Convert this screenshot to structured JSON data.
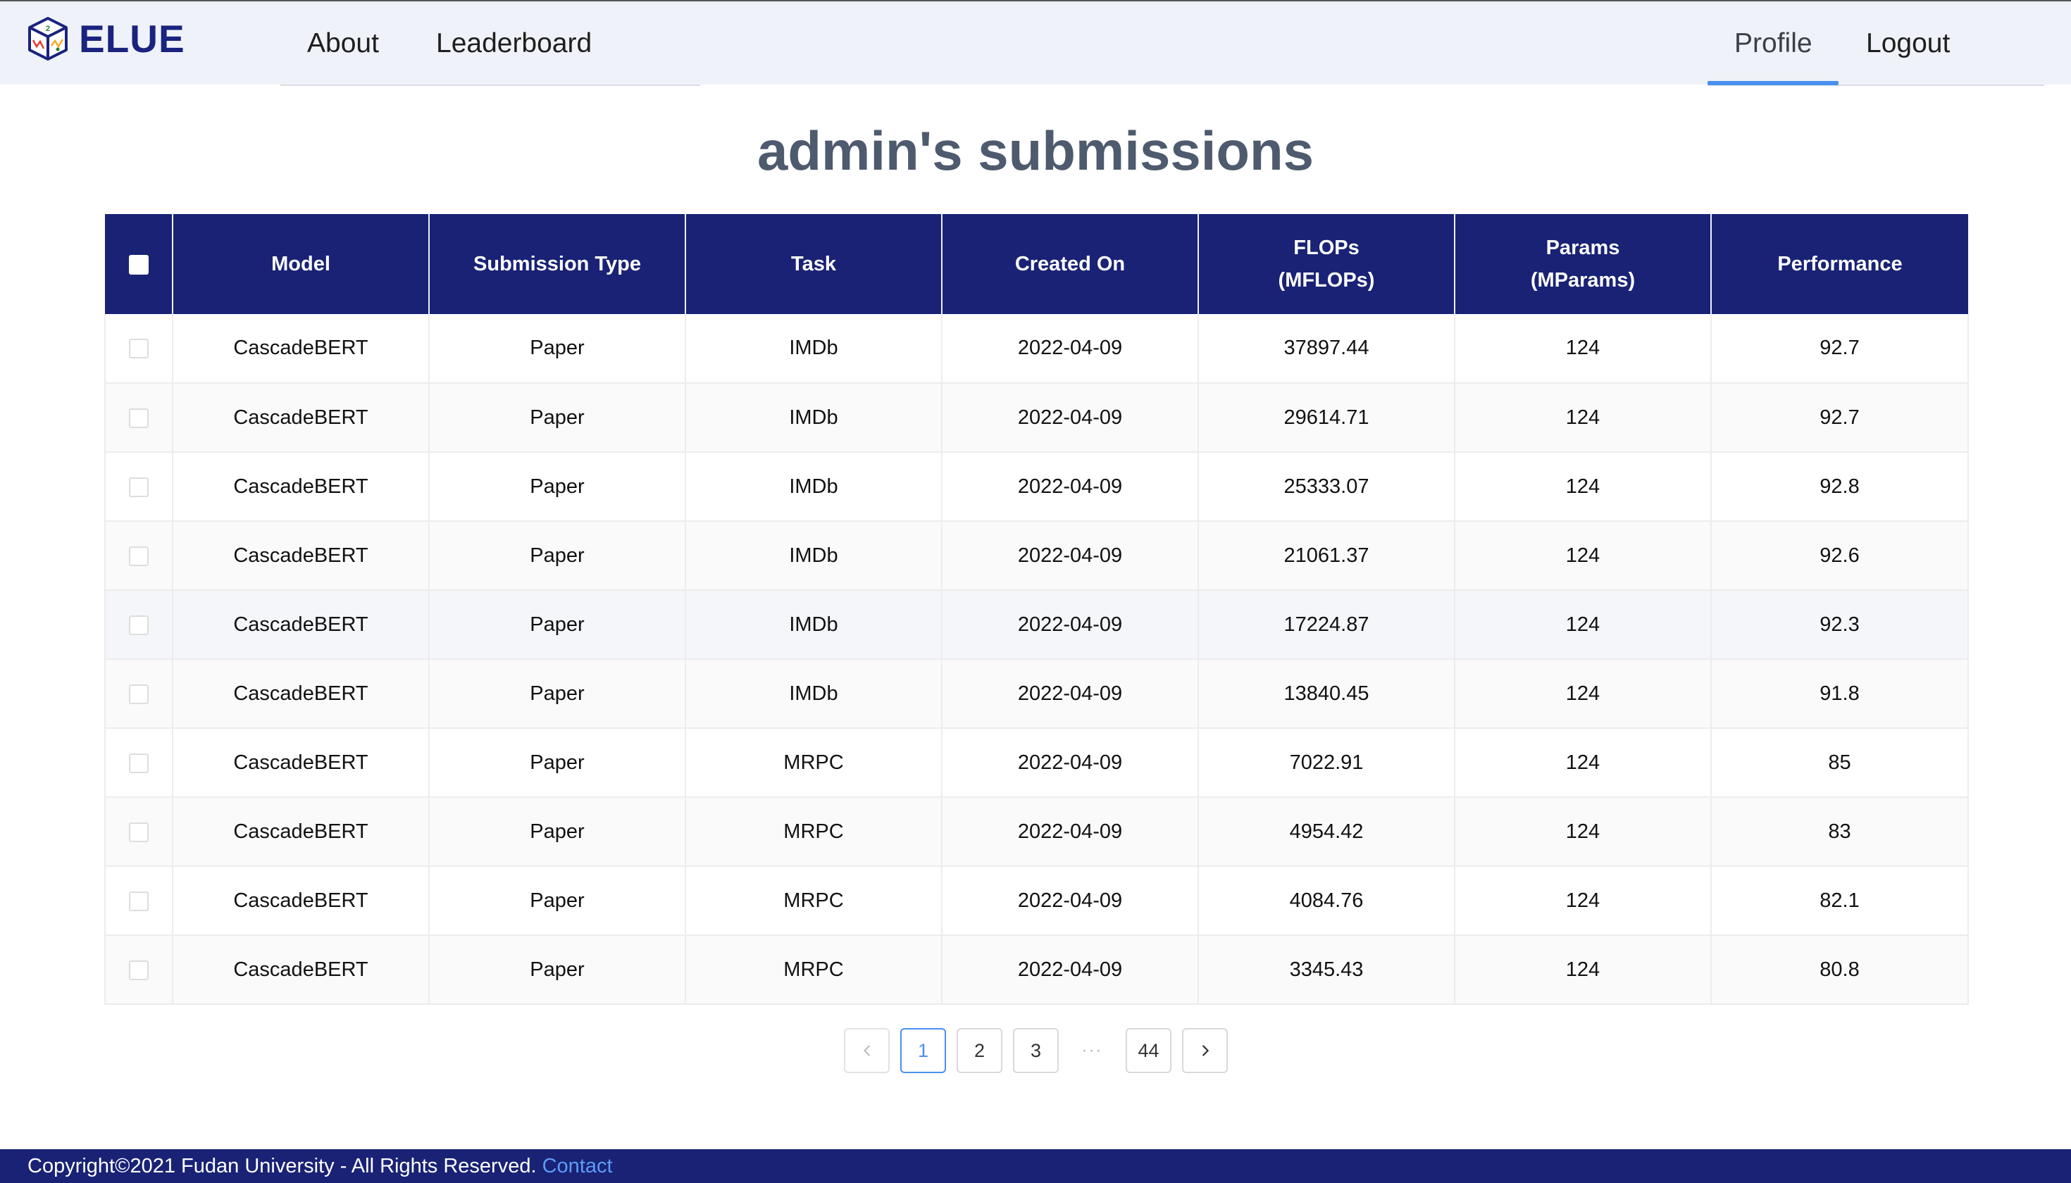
{
  "brand": {
    "name": "ELUE"
  },
  "nav": {
    "about": "About",
    "leaderboard": "Leaderboard",
    "profile": "Profile",
    "logout": "Logout",
    "active": "Profile"
  },
  "page": {
    "title": "admin's submissions"
  },
  "table": {
    "columns": [
      {
        "line1": "Model",
        "line2": ""
      },
      {
        "line1": "Submission Type",
        "line2": ""
      },
      {
        "line1": "Task",
        "line2": ""
      },
      {
        "line1": "Created On",
        "line2": ""
      },
      {
        "line1": "FLOPs",
        "line2": "(MFLOPs)"
      },
      {
        "line1": "Params",
        "line2": "(MParams)"
      },
      {
        "line1": "Performance",
        "line2": ""
      }
    ],
    "rows": [
      {
        "model": "CascadeBERT",
        "type": "Paper",
        "task": "IMDb",
        "created": "2022-04-09",
        "flops": "37897.44",
        "params": "124",
        "performance": "92.7"
      },
      {
        "model": "CascadeBERT",
        "type": "Paper",
        "task": "IMDb",
        "created": "2022-04-09",
        "flops": "29614.71",
        "params": "124",
        "performance": "92.7"
      },
      {
        "model": "CascadeBERT",
        "type": "Paper",
        "task": "IMDb",
        "created": "2022-04-09",
        "flops": "25333.07",
        "params": "124",
        "performance": "92.8"
      },
      {
        "model": "CascadeBERT",
        "type": "Paper",
        "task": "IMDb",
        "created": "2022-04-09",
        "flops": "21061.37",
        "params": "124",
        "performance": "92.6"
      },
      {
        "model": "CascadeBERT",
        "type": "Paper",
        "task": "IMDb",
        "created": "2022-04-09",
        "flops": "17224.87",
        "params": "124",
        "performance": "92.3"
      },
      {
        "model": "CascadeBERT",
        "type": "Paper",
        "task": "IMDb",
        "created": "2022-04-09",
        "flops": "13840.45",
        "params": "124",
        "performance": "91.8"
      },
      {
        "model": "CascadeBERT",
        "type": "Paper",
        "task": "MRPC",
        "created": "2022-04-09",
        "flops": "7022.91",
        "params": "124",
        "performance": "85"
      },
      {
        "model": "CascadeBERT",
        "type": "Paper",
        "task": "MRPC",
        "created": "2022-04-09",
        "flops": "4954.42",
        "params": "124",
        "performance": "83"
      },
      {
        "model": "CascadeBERT",
        "type": "Paper",
        "task": "MRPC",
        "created": "2022-04-09",
        "flops": "4084.76",
        "params": "124",
        "performance": "82.1"
      },
      {
        "model": "CascadeBERT",
        "type": "Paper",
        "task": "MRPC",
        "created": "2022-04-09",
        "flops": "3345.43",
        "params": "124",
        "performance": "80.8"
      }
    ],
    "hovered_row": 4
  },
  "pagination": {
    "pages": [
      "1",
      "2",
      "3"
    ],
    "ellipsis": "···",
    "last": "44",
    "current": "1",
    "prev_icon": "chevron-left-icon",
    "next_icon": "chevron-right-icon"
  },
  "footer": {
    "copyright": "Copyright©2021 Fudan University - All Rights Reserved.",
    "contact": "Contact"
  },
  "colors": {
    "brand": "#1a237e",
    "header_bg": "#192275",
    "accent": "#4a8ff0",
    "title": "#4e5a6e",
    "nav_bg": "#eff2f8"
  }
}
